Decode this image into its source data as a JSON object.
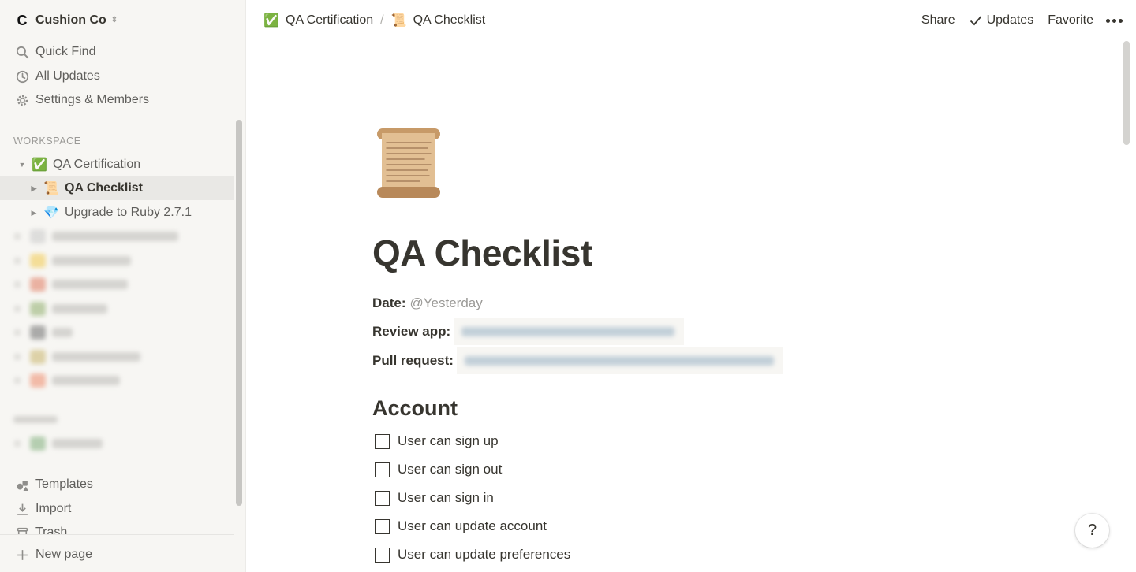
{
  "workspace": {
    "name": "Cushion Co",
    "logo_letter": "C"
  },
  "sidebar": {
    "quick_links": [
      {
        "label": "Quick Find",
        "icon": "search-icon"
      },
      {
        "label": "All Updates",
        "icon": "clock-icon"
      },
      {
        "label": "Settings & Members",
        "icon": "gear-icon"
      }
    ],
    "section_label": "WORKSPACE",
    "tree": [
      {
        "label": "QA Certification",
        "emoji": "✅"
      },
      {
        "label": "QA Checklist",
        "emoji": "📜"
      },
      {
        "label": "Upgrade to Ruby 2.7.1",
        "emoji": "💎"
      }
    ],
    "bottom_links": [
      {
        "label": "Templates",
        "icon": "shapes-icon"
      },
      {
        "label": "Import",
        "icon": "download-icon"
      },
      {
        "label": "Trash",
        "icon": "trash-icon"
      }
    ],
    "new_page_label": "New page"
  },
  "topbar": {
    "breadcrumb": [
      {
        "label": "QA Certification",
        "emoji": "✅"
      },
      {
        "label": "QA Checklist",
        "emoji": "📜"
      }
    ],
    "breadcrumb_separator": "/",
    "share_label": "Share",
    "updates_label": "Updates",
    "favorite_label": "Favorite"
  },
  "page": {
    "icon": "scroll-icon",
    "title": "QA Checklist",
    "properties": {
      "date_label": "Date:",
      "date_value": "@Yesterday",
      "review_label": "Review app:",
      "pull_label": "Pull request:"
    },
    "section_heading": "Account",
    "todos": [
      {
        "label": "User can sign up",
        "checked": false
      },
      {
        "label": "User can sign out",
        "checked": false
      },
      {
        "label": "User can sign in",
        "checked": false
      },
      {
        "label": "User can update account",
        "checked": false
      },
      {
        "label": "User can update preferences",
        "checked": false
      }
    ]
  },
  "help": {
    "label": "?"
  }
}
